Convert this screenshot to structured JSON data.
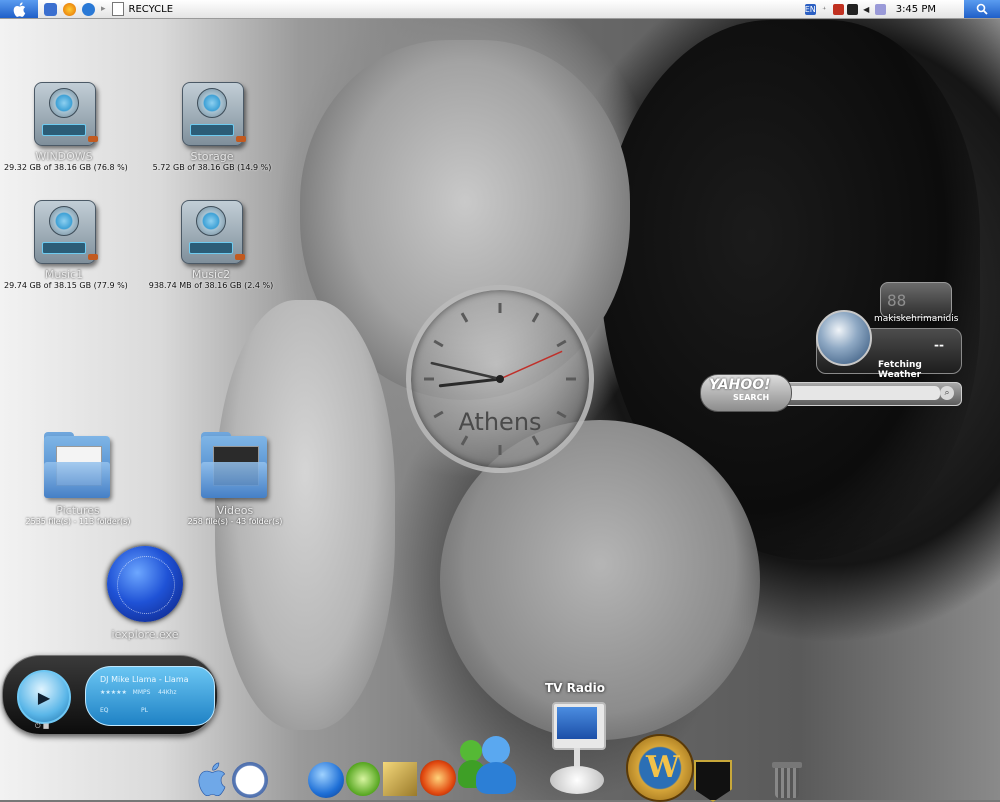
{
  "menubar": {
    "window_title": "RECYCLE",
    "tray_language": "EN",
    "clock": "3:45 PM"
  },
  "desktop_icons": [
    {
      "name": "WINDOWS",
      "detail": "29.32 GB of 38.16 GB (76.8 %)"
    },
    {
      "name": "Storage",
      "detail": "5.72 GB of 38.16 GB (14.9 %)"
    },
    {
      "name": "Music1",
      "detail": "29.74 GB of 38.15 GB (77.9 %)"
    },
    {
      "name": "Music2",
      "detail": "938.74 MB of 38.16 GB (2.4 %)"
    },
    {
      "name": "Pictures",
      "detail": "2535 file(s) - 113 folder(s)"
    },
    {
      "name": "Videos",
      "detail": "258 file(s) - 43 folder(s)"
    },
    {
      "name": "iexplore.exe",
      "detail": ""
    }
  ],
  "clock_widget": {
    "city": "Athens",
    "hour": 8,
    "minute": 47,
    "second": 11
  },
  "weather_widget": {
    "lcd": "88",
    "user": "makiskehrimanidis",
    "status": "Fetching Weather",
    "temp": "--"
  },
  "yahoo_search": {
    "logo": "YAHOO!",
    "label": "SEARCH",
    "placeholder": ""
  },
  "media_player": {
    "track": "DJ Mike Llama - Llama",
    "info_left": "★★★★★",
    "info_mid": "MMPS",
    "info_right": "44Khz",
    "row2_left": "EQ",
    "row2_right": "PL"
  },
  "dock": {
    "label": "TV Radio"
  },
  "colors": {
    "menubar_accent": "#1f5fc8",
    "drive_disc": "#3ea1d6",
    "player_screen": "#1f82c5"
  }
}
